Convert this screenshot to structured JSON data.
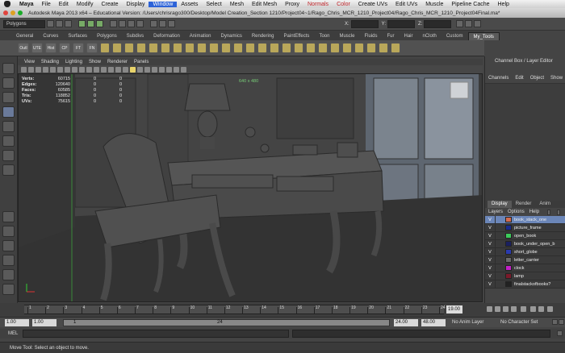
{
  "menubar": {
    "app": "Maya",
    "items": [
      "File",
      "Edit",
      "Modify",
      "Create",
      "Display",
      "Window",
      "Assets",
      "Select",
      "Mesh",
      "Edit Mesh",
      "Proxy",
      "Normals",
      "Color",
      "Create UVs",
      "Edit UVs",
      "Muscle",
      "Pipeline Cache",
      "Help"
    ],
    "highlighted": "Window",
    "red_items": [
      "Normals",
      "Color"
    ]
  },
  "title": "Autodesk Maya 2013 x64 – Educational Version: /Users/chrisrago300/Desktop/Model Creation_Section 1210/Project04~1/Rago_Chris_MCR_1210_Project04/Rago_Chris_MCR_1210_Project04Final.ma*",
  "statusline": {
    "menuset": "Polygons",
    "x_label": "X:",
    "y_label": "Y:",
    "z_label": "Z:"
  },
  "shelf": {
    "tabs": [
      "General",
      "Curves",
      "Surfaces",
      "Polygons",
      "Subdivs",
      "Deformation",
      "Animation",
      "Dynamics",
      "Rendering",
      "PaintEffects",
      "Toon",
      "Muscle",
      "Fluids",
      "Fur",
      "Hair",
      "nCloth",
      "Custom",
      "My_Tools"
    ],
    "active_tab": "My_Tools",
    "labeled_icons": [
      "Outl",
      "UTE",
      "Hist",
      "CP",
      "FT",
      "FN"
    ]
  },
  "viewport": {
    "menu": [
      "View",
      "Shading",
      "Lighting",
      "Show",
      "Renderer",
      "Panels"
    ],
    "hud": [
      {
        "k": "Verts:",
        "v": "60715",
        "w": "0",
        "x": "0"
      },
      {
        "k": "Edges:",
        "v": "120640",
        "w": "0",
        "x": "0"
      },
      {
        "k": "Faces:",
        "v": "60585",
        "w": "0",
        "x": "0"
      },
      {
        "k": "Tris:",
        "v": "118852",
        "w": "0",
        "x": "0"
      },
      {
        "k": "UVs:",
        "v": "75615",
        "w": "0",
        "x": "0"
      }
    ],
    "camera_label": "640 x 480"
  },
  "channelbox": {
    "title": "Channel Box / Layer Editor",
    "menu": [
      "Channels",
      "Edit",
      "Object",
      "Show"
    ]
  },
  "layers": {
    "tabs": [
      "Display",
      "Render",
      "Anim"
    ],
    "active_tab": "Display",
    "menu": [
      "Layers",
      "Options",
      "Help"
    ],
    "rows": [
      {
        "name": "book_stack_one",
        "vis": "V",
        "color": "#d26a4f",
        "selected": true
      },
      {
        "name": "picture_frame",
        "vis": "V",
        "color": "#1a2b8a",
        "selected": false
      },
      {
        "name": "open_book",
        "vis": "V",
        "color": "#3ccb5a",
        "selected": false
      },
      {
        "name": "book_under_open_b",
        "vis": "V",
        "color": "#1a2060",
        "selected": false
      },
      {
        "name": "short_globe",
        "vis": "V",
        "color": "#2a3bb0",
        "selected": false
      },
      {
        "name": "letter_carrier",
        "vis": "V",
        "color": "#6a6a6a",
        "selected": false
      },
      {
        "name": "clock",
        "vis": "V",
        "color": "#c320c8",
        "selected": false
      },
      {
        "name": "lamp",
        "vis": "V",
        "color": "#7b1a2a",
        "selected": false
      },
      {
        "name": "finalstackofbooks?",
        "vis": "V",
        "color": "#222222",
        "selected": false
      }
    ]
  },
  "timeline": {
    "tick_labels": [
      "1",
      "2",
      "3",
      "4",
      "5",
      "6",
      "7",
      "8",
      "9",
      "10",
      "11",
      "12",
      "13",
      "14",
      "15",
      "16",
      "17",
      "18",
      "19",
      "20",
      "21",
      "22",
      "23",
      "24"
    ],
    "current_frame": "19.00"
  },
  "range": {
    "start": "1.00",
    "playback_start": "1.00",
    "slider_start": "1",
    "slider_end": "24",
    "playback_end": "24.00",
    "end": "48.00",
    "anim_layer": "No Anim Layer",
    "character_set": "No Character Set"
  },
  "mel": {
    "label": "MEL"
  },
  "help": {
    "text": "Move Tool: Select an object to move."
  }
}
